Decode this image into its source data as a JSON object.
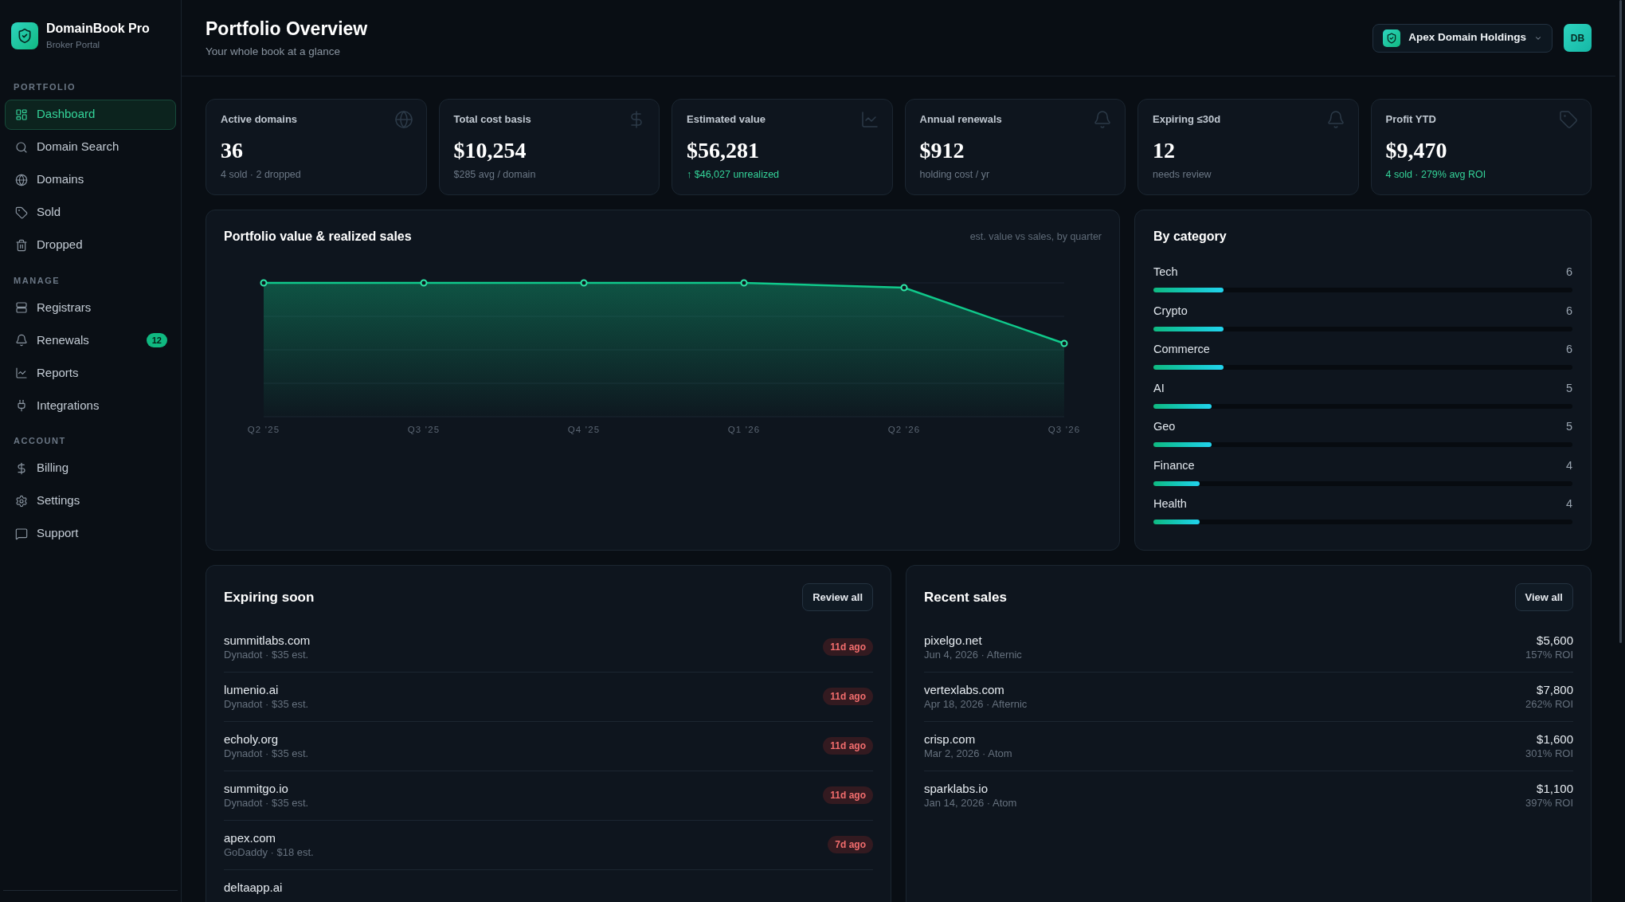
{
  "sidebar": {
    "brand": {
      "title": "DomainBook Pro",
      "subtitle": "Broker Portal"
    },
    "sections": [
      {
        "label": "PORTFOLIO",
        "items": [
          {
            "label": "Dashboard",
            "selected": true
          },
          {
            "label": "Domain Search",
            "selected": false
          },
          {
            "label": "Domains",
            "selected": false
          },
          {
            "label": "Sold",
            "selected": false
          },
          {
            "label": "Dropped",
            "selected": false
          }
        ]
      },
      {
        "label": "MANAGE",
        "items": [
          {
            "label": "Registrars",
            "selected": false
          },
          {
            "label": "Renewals",
            "selected": false,
            "badge": "12"
          },
          {
            "label": "Reports",
            "selected": false
          },
          {
            "label": "Integrations",
            "selected": false
          }
        ]
      },
      {
        "label": "ACCOUNT",
        "items": [
          {
            "label": "Billing",
            "selected": false
          },
          {
            "label": "Settings",
            "selected": false
          },
          {
            "label": "Support",
            "selected": false
          }
        ]
      }
    ]
  },
  "header": {
    "title": "Portfolio Overview",
    "subtitle": "Your whole book at a glance",
    "account_switcher": {
      "label": "Apex Domain Holdings"
    },
    "avatar": {
      "initials": "DB"
    }
  },
  "stats": [
    {
      "label": "Active domains",
      "value": "36",
      "note": "4 sold · 2 dropped",
      "positive": false
    },
    {
      "label": "Total cost basis",
      "value": "$10,254",
      "note": "$285 avg / domain",
      "positive": false
    },
    {
      "label": "Estimated value",
      "value": "$56,281",
      "note": "↑ $46,027 unrealized",
      "positive": true
    },
    {
      "label": "Annual renewals",
      "value": "$912",
      "note": "holding cost / yr",
      "positive": false
    },
    {
      "label": "Expiring ≤30d",
      "value": "12",
      "note": "needs review",
      "positive": false
    },
    {
      "label": "Profit YTD",
      "value": "$9,470",
      "note": "4 sold · 279% avg ROI",
      "positive": true
    }
  ],
  "value_chart": {
    "title": "Portfolio value & realized sales",
    "caption": "est. value vs sales, by quarter",
    "x_labels": [
      "Q2 '25",
      "Q3 '25",
      "Q4 '25",
      "Q1 '26",
      "Q2 '26",
      "Q3 '26"
    ]
  },
  "categories": {
    "title": "By category",
    "items": [
      {
        "name": "Tech",
        "count": "6",
        "level": 0.167
      },
      {
        "name": "Crypto",
        "count": "6",
        "level": 0.167
      },
      {
        "name": "Commerce",
        "count": "6",
        "level": 0.167
      },
      {
        "name": "AI",
        "count": "5",
        "level": 0.139
      },
      {
        "name": "Geo",
        "count": "5",
        "level": 0.139
      },
      {
        "name": "Finance",
        "count": "4",
        "level": 0.111
      },
      {
        "name": "Health",
        "count": "4",
        "level": 0.111
      }
    ]
  },
  "expiring": {
    "title": "Expiring soon",
    "action": "Review all",
    "rows": [
      {
        "domain": "summitlabs.com",
        "detail": "Dynadot · $35 est.",
        "badge": "11d ago"
      },
      {
        "domain": "lumenio.ai",
        "detail": "Dynadot · $35 est.",
        "badge": "11d ago"
      },
      {
        "domain": "echoly.org",
        "detail": "Dynadot · $35 est.",
        "badge": "11d ago"
      },
      {
        "domain": "summitgo.io",
        "detail": "Dynadot · $35 est.",
        "badge": "11d ago"
      },
      {
        "domain": "apex.com",
        "detail": "GoDaddy · $18 est.",
        "badge": "7d ago"
      },
      {
        "domain": "deltaapp.ai"
      }
    ]
  },
  "recent_sales": {
    "title": "Recent sales",
    "action": "View all",
    "rows": [
      {
        "domain": "pixelgo.net",
        "detail": "Jun 4, 2026 · Afternic",
        "price": "$5,600",
        "roi": "157% ROI"
      },
      {
        "domain": "vertexlabs.com",
        "detail": "Apr 18, 2026 · Afternic",
        "price": "$7,800",
        "roi": "262% ROI"
      },
      {
        "domain": "crisp.com",
        "detail": "Mar 2, 2026 · Atom",
        "price": "$1,600",
        "roi": "301% ROI"
      },
      {
        "domain": "sparklabs.io",
        "detail": "Jan 14, 2026 · Atom",
        "price": "$1,100",
        "roi": "397% ROI"
      }
    ]
  }
}
